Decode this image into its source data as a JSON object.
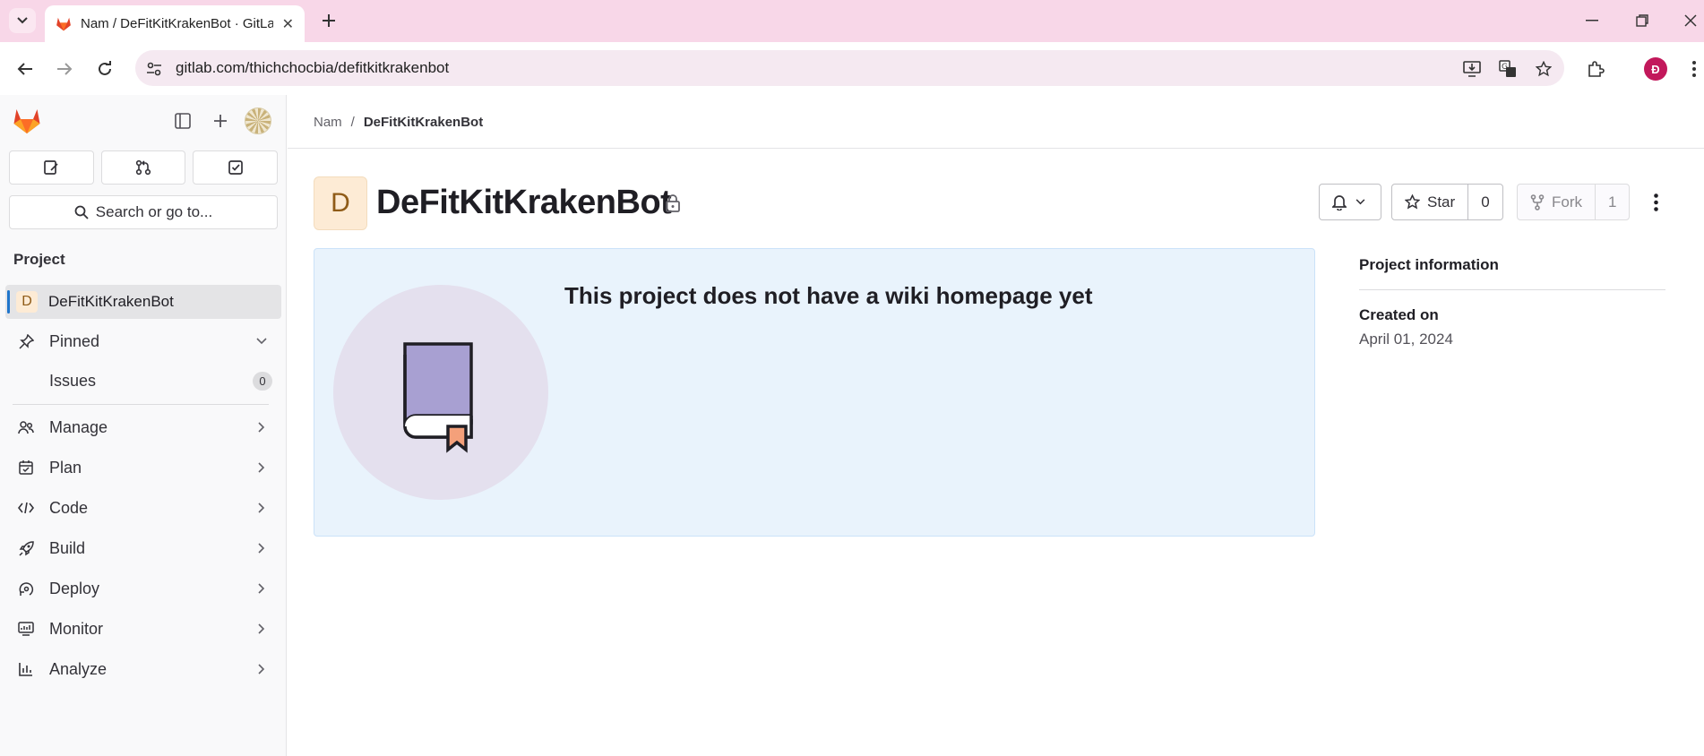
{
  "browser": {
    "tab_title": "Nam / DeFitKitKrakenBot · GitLab",
    "url": "gitlab.com/thichchocbia/defitkitkrakenbot",
    "profile_initial": "Đ"
  },
  "sidebar": {
    "search_placeholder": "Search or go to...",
    "section_title": "Project",
    "project": {
      "avatar_letter": "D",
      "name": "DeFitKitKrakenBot"
    },
    "pinned_label": "Pinned",
    "pinned_items": [
      {
        "label": "Issues",
        "count": "0"
      }
    ],
    "nav_items": [
      {
        "label": "Manage",
        "icon": "users-icon"
      },
      {
        "label": "Plan",
        "icon": "planning-icon"
      },
      {
        "label": "Code",
        "icon": "code-icon"
      },
      {
        "label": "Build",
        "icon": "rocket-icon"
      },
      {
        "label": "Deploy",
        "icon": "deployments-icon"
      },
      {
        "label": "Monitor",
        "icon": "monitor-icon"
      },
      {
        "label": "Analyze",
        "icon": "chart-icon"
      }
    ]
  },
  "breadcrumbs": [
    "Nam",
    "/",
    "DeFitKitKrakenBot"
  ],
  "project_header": {
    "avatar_letter": "D",
    "title": "DeFitKitKrakenBot",
    "star_label": "Star",
    "star_count": "0",
    "fork_label": "Fork",
    "fork_count": "1"
  },
  "wiki": {
    "empty_title": "This project does not have a wiki homepage yet"
  },
  "project_info": {
    "heading": "Project information",
    "created_label": "Created on",
    "created_value": "April 01, 2024"
  },
  "colors": {
    "accent": "#1f75cb",
    "tabbar": "#f8d7e8",
    "empty_state_bg": "#e9f3fc"
  }
}
